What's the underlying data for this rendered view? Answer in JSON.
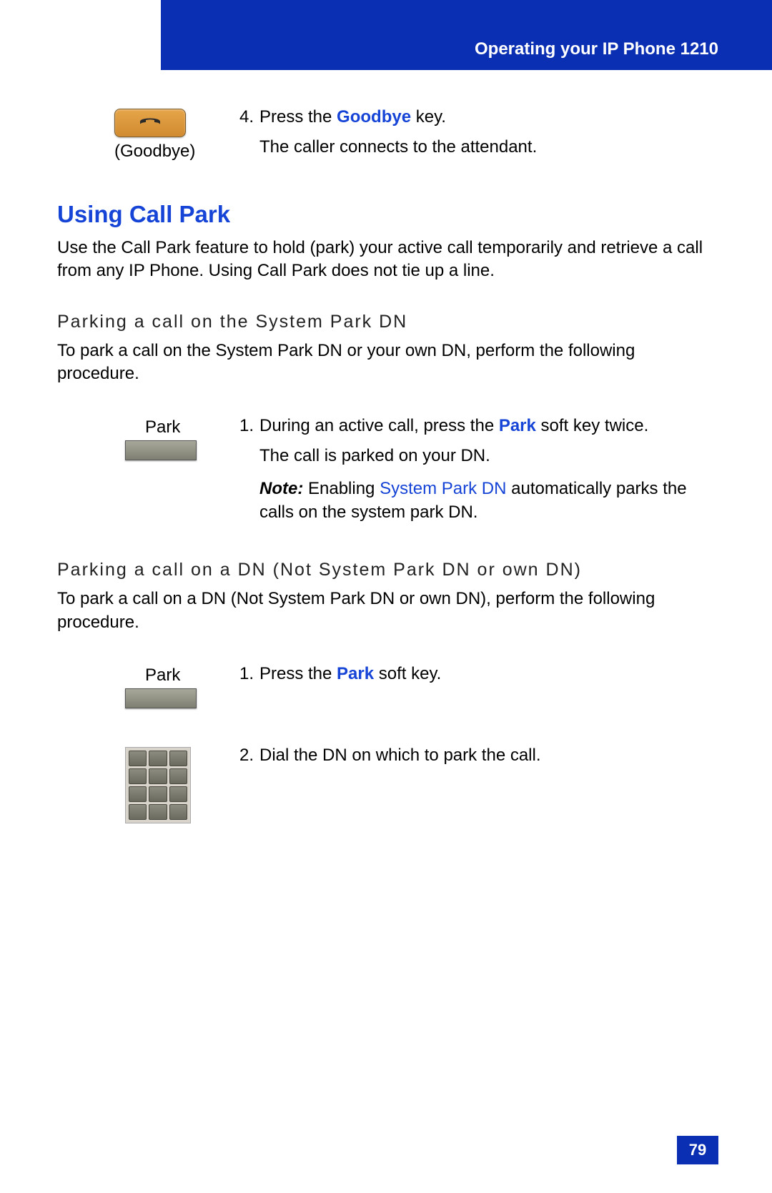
{
  "header": {
    "title": "Operating your IP Phone 1210"
  },
  "step4": {
    "iconCaption": "(Goodbye)",
    "num": "4.",
    "line1_a": "Press the ",
    "line1_b": "Goodbye",
    "line1_c": " key.",
    "line2": "The caller connects to the attendant."
  },
  "section1": {
    "title": "Using Call Park",
    "body": "Use the Call Park feature to hold (park) your active call temporarily and retrieve a call from any IP Phone. Using Call Park does not tie up a line."
  },
  "sub1": {
    "heading": "Parking a call on the System Park DN",
    "body": "To park a call on the System Park DN or your own DN, perform the following procedure."
  },
  "step1a": {
    "keyLabel": "Park",
    "num": "1.",
    "line1_a": "During an active call, press the ",
    "line1_b": "Park",
    "line1_c": " soft key twice.",
    "line2": "The call is parked on your DN.",
    "note_prefix": "Note:",
    "note_a": "  Enabling ",
    "note_link": "System Park DN",
    "note_b": " automatically parks the calls on the system park DN."
  },
  "sub2": {
    "heading": "Parking a call on a DN (Not System Park DN or own DN)",
    "body": "To park a call on a DN (Not System Park DN or own DN), perform the following procedure."
  },
  "step1b": {
    "keyLabel": "Park",
    "num": "1.",
    "line1_a": "Press the ",
    "line1_b": "Park",
    "line1_c": " soft key."
  },
  "step2b": {
    "num": "2.",
    "line1": "Dial the DN on which to park the call."
  },
  "pageNumber": "79"
}
